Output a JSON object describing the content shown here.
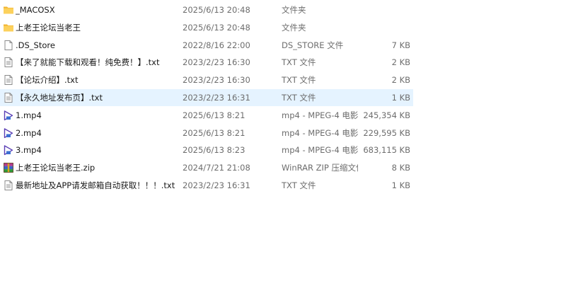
{
  "files": [
    {
      "name": "_MACOSX",
      "date": "2025/6/13 20:48",
      "type": "文件夹",
      "size": "",
      "icon": "folder-icon"
    },
    {
      "name": "上老王论坛当老王",
      "date": "2025/6/13 20:48",
      "type": "文件夹",
      "size": "",
      "icon": "folder-icon"
    },
    {
      "name": ".DS_Store",
      "date": "2022/8/16 22:00",
      "type": "DS_STORE 文件",
      "size": "7 KB",
      "icon": "generic-file-icon"
    },
    {
      "name": "【来了就能下载和观看！纯免费！】.txt",
      "date": "2023/2/23 16:30",
      "type": "TXT 文件",
      "size": "2 KB",
      "icon": "text-file-icon"
    },
    {
      "name": "【论坛介绍】.txt",
      "date": "2023/2/23 16:30",
      "type": "TXT 文件",
      "size": "2 KB",
      "icon": "text-file-icon"
    },
    {
      "name": "【永久地址发布页】.txt",
      "date": "2023/2/23 16:31",
      "type": "TXT 文件",
      "size": "1 KB",
      "icon": "text-file-icon",
      "selected": true
    },
    {
      "name": "1.mp4",
      "date": "2025/6/13 8:21",
      "type": "mp4 - MPEG-4 电影...",
      "size": "245,354 KB",
      "icon": "video-file-icon"
    },
    {
      "name": "2.mp4",
      "date": "2025/6/13 8:21",
      "type": "mp4 - MPEG-4 电影...",
      "size": "229,595 KB",
      "icon": "video-file-icon"
    },
    {
      "name": "3.mp4",
      "date": "2025/6/13 8:23",
      "type": "mp4 - MPEG-4 电影...",
      "size": "683,115 KB",
      "icon": "video-file-icon"
    },
    {
      "name": "上老王论坛当老王.zip",
      "date": "2024/7/21 21:08",
      "type": "WinRAR ZIP 压缩文件",
      "size": "8 KB",
      "icon": "winrar-archive-icon"
    },
    {
      "name": "最新地址及APP请发邮箱自动获取！！！.txt",
      "date": "2023/2/23 16:31",
      "type": "TXT 文件",
      "size": "1 KB",
      "icon": "text-file-icon"
    }
  ],
  "colors": {
    "selected_row": "#e5f3ff",
    "folder": "#f7c948",
    "video_accent": "#5b3fb5"
  }
}
